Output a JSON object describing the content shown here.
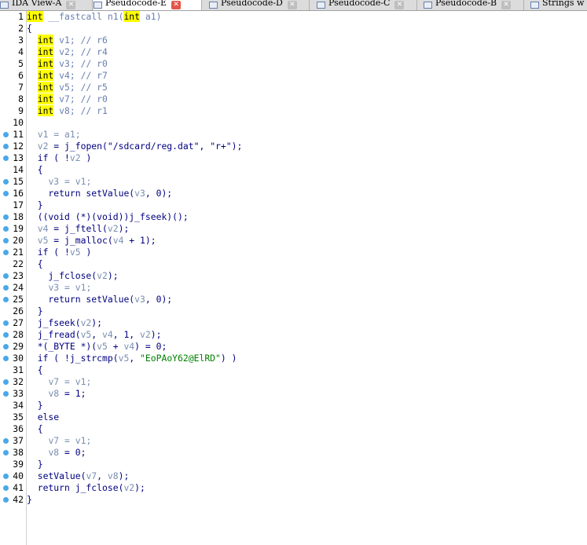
{
  "tabs": [
    {
      "label": "IDA View-A",
      "active": false
    },
    {
      "label": "Pseudocode-E",
      "active": true
    },
    {
      "label": "Pseudocode-D",
      "active": false
    },
    {
      "label": "Pseudocode-C",
      "active": false
    },
    {
      "label": "Pseudocode-B",
      "active": false
    },
    {
      "label": "Strings w",
      "active": false
    }
  ],
  "colors": {
    "keyword_highlight": "#ffff00",
    "breakpoint_dot": "#4aa8e8",
    "string": "#008000",
    "variable": "#7a8fb0",
    "code": "#000080"
  },
  "lines": [
    {
      "n": "1",
      "bp": false,
      "tokens": [
        {
          "t": "int",
          "c": "kw"
        },
        {
          "t": " __fastcall n1(",
          "c": "cmt"
        },
        {
          "t": "int",
          "c": "kw"
        },
        {
          "t": " a1)",
          "c": "cmt"
        }
      ]
    },
    {
      "n": "2",
      "bp": false,
      "tokens": [
        {
          "t": "{",
          "c": "fn"
        }
      ]
    },
    {
      "n": "3",
      "bp": false,
      "tokens": [
        {
          "t": "  ",
          "c": "fn"
        },
        {
          "t": "int",
          "c": "kw"
        },
        {
          "t": " v1; // r6",
          "c": "cmt"
        }
      ]
    },
    {
      "n": "4",
      "bp": false,
      "tokens": [
        {
          "t": "  ",
          "c": "fn"
        },
        {
          "t": "int",
          "c": "kw"
        },
        {
          "t": " v2; // r4",
          "c": "cmt"
        }
      ]
    },
    {
      "n": "5",
      "bp": false,
      "tokens": [
        {
          "t": "  ",
          "c": "fn"
        },
        {
          "t": "int",
          "c": "kw"
        },
        {
          "t": " v3; // r0",
          "c": "cmt"
        }
      ]
    },
    {
      "n": "6",
      "bp": false,
      "tokens": [
        {
          "t": "  ",
          "c": "fn"
        },
        {
          "t": "int",
          "c": "kw"
        },
        {
          "t": " v4; // r7",
          "c": "cmt"
        }
      ]
    },
    {
      "n": "7",
      "bp": false,
      "tokens": [
        {
          "t": "  ",
          "c": "fn"
        },
        {
          "t": "int",
          "c": "kw"
        },
        {
          "t": " v5; // r5",
          "c": "cmt"
        }
      ]
    },
    {
      "n": "8",
      "bp": false,
      "tokens": [
        {
          "t": "  ",
          "c": "fn"
        },
        {
          "t": "int",
          "c": "kw"
        },
        {
          "t": " v7; // r0",
          "c": "cmt"
        }
      ]
    },
    {
      "n": "9",
      "bp": false,
      "tokens": [
        {
          "t": "  ",
          "c": "fn"
        },
        {
          "t": "int",
          "c": "kw"
        },
        {
          "t": " v8; // r1",
          "c": "cmt"
        }
      ]
    },
    {
      "n": "10",
      "bp": false,
      "tokens": []
    },
    {
      "n": "11",
      "bp": true,
      "tokens": [
        {
          "t": "  ",
          "c": "fn"
        },
        {
          "t": "v1 = a1;",
          "c": "var"
        }
      ]
    },
    {
      "n": "12",
      "bp": true,
      "tokens": [
        {
          "t": "  ",
          "c": "fn"
        },
        {
          "t": "v2",
          "c": "var"
        },
        {
          "t": " = j_fopen(",
          "c": "fn"
        },
        {
          "t": "\"/sdcard/reg.dat\"",
          "c": "fn"
        },
        {
          "t": ", ",
          "c": "fn"
        },
        {
          "t": "\"r+\"",
          "c": "fn"
        },
        {
          "t": ");",
          "c": "fn"
        }
      ]
    },
    {
      "n": "13",
      "bp": true,
      "tokens": [
        {
          "t": "  if ( !",
          "c": "fn"
        },
        {
          "t": "v2",
          "c": "var"
        },
        {
          "t": " )",
          "c": "fn"
        }
      ]
    },
    {
      "n": "14",
      "bp": false,
      "tokens": [
        {
          "t": "  {",
          "c": "fn"
        }
      ]
    },
    {
      "n": "15",
      "bp": true,
      "tokens": [
        {
          "t": "    ",
          "c": "fn"
        },
        {
          "t": "v3 = v1;",
          "c": "var"
        }
      ]
    },
    {
      "n": "16",
      "bp": true,
      "tokens": [
        {
          "t": "    return setValue(",
          "c": "fn"
        },
        {
          "t": "v3",
          "c": "var"
        },
        {
          "t": ", 0);",
          "c": "fn"
        }
      ]
    },
    {
      "n": "17",
      "bp": false,
      "tokens": [
        {
          "t": "  }",
          "c": "fn"
        }
      ]
    },
    {
      "n": "18",
      "bp": true,
      "tokens": [
        {
          "t": "  ((void (*)(void))j_fseek)();",
          "c": "fn"
        }
      ]
    },
    {
      "n": "19",
      "bp": true,
      "tokens": [
        {
          "t": "  ",
          "c": "fn"
        },
        {
          "t": "v4",
          "c": "var"
        },
        {
          "t": " = j_ftell(",
          "c": "fn"
        },
        {
          "t": "v2",
          "c": "var"
        },
        {
          "t": ");",
          "c": "fn"
        }
      ]
    },
    {
      "n": "20",
      "bp": true,
      "tokens": [
        {
          "t": "  ",
          "c": "fn"
        },
        {
          "t": "v5",
          "c": "var"
        },
        {
          "t": " = j_malloc(",
          "c": "fn"
        },
        {
          "t": "v4",
          "c": "var"
        },
        {
          "t": " + 1);",
          "c": "fn"
        }
      ]
    },
    {
      "n": "21",
      "bp": true,
      "tokens": [
        {
          "t": "  if ( !",
          "c": "fn"
        },
        {
          "t": "v5",
          "c": "var"
        },
        {
          "t": " )",
          "c": "fn"
        }
      ]
    },
    {
      "n": "22",
      "bp": false,
      "tokens": [
        {
          "t": "  {",
          "c": "fn"
        }
      ]
    },
    {
      "n": "23",
      "bp": true,
      "tokens": [
        {
          "t": "    j_fclose(",
          "c": "fn"
        },
        {
          "t": "v2",
          "c": "var"
        },
        {
          "t": ");",
          "c": "fn"
        }
      ]
    },
    {
      "n": "24",
      "bp": true,
      "tokens": [
        {
          "t": "    ",
          "c": "fn"
        },
        {
          "t": "v3 = v1;",
          "c": "var"
        }
      ]
    },
    {
      "n": "25",
      "bp": true,
      "tokens": [
        {
          "t": "    return setValue(",
          "c": "fn"
        },
        {
          "t": "v3",
          "c": "var"
        },
        {
          "t": ", 0);",
          "c": "fn"
        }
      ]
    },
    {
      "n": "26",
      "bp": false,
      "tokens": [
        {
          "t": "  }",
          "c": "fn"
        }
      ]
    },
    {
      "n": "27",
      "bp": true,
      "tokens": [
        {
          "t": "  j_fseek(",
          "c": "fn"
        },
        {
          "t": "v2",
          "c": "var"
        },
        {
          "t": ");",
          "c": "fn"
        }
      ]
    },
    {
      "n": "28",
      "bp": true,
      "tokens": [
        {
          "t": "  j_fread(",
          "c": "fn"
        },
        {
          "t": "v5",
          "c": "var"
        },
        {
          "t": ", ",
          "c": "fn"
        },
        {
          "t": "v4",
          "c": "var"
        },
        {
          "t": ", 1, ",
          "c": "fn"
        },
        {
          "t": "v2",
          "c": "var"
        },
        {
          "t": ");",
          "c": "fn"
        }
      ]
    },
    {
      "n": "29",
      "bp": true,
      "tokens": [
        {
          "t": "  *(_BYTE *)(",
          "c": "fn"
        },
        {
          "t": "v5",
          "c": "var"
        },
        {
          "t": " + ",
          "c": "fn"
        },
        {
          "t": "v4",
          "c": "var"
        },
        {
          "t": ") = 0;",
          "c": "fn"
        }
      ]
    },
    {
      "n": "30",
      "bp": true,
      "tokens": [
        {
          "t": "  if ( !j_strcmp(",
          "c": "fn"
        },
        {
          "t": "v5",
          "c": "var"
        },
        {
          "t": ", ",
          "c": "fn"
        },
        {
          "t": "\"EoPAoY62@ElRD\"",
          "c": "str"
        },
        {
          "t": ") )",
          "c": "fn"
        }
      ]
    },
    {
      "n": "31",
      "bp": false,
      "tokens": [
        {
          "t": "  {",
          "c": "fn"
        }
      ]
    },
    {
      "n": "32",
      "bp": true,
      "tokens": [
        {
          "t": "    ",
          "c": "fn"
        },
        {
          "t": "v7 = v1;",
          "c": "var"
        }
      ]
    },
    {
      "n": "33",
      "bp": true,
      "tokens": [
        {
          "t": "    ",
          "c": "fn"
        },
        {
          "t": "v8",
          "c": "var"
        },
        {
          "t": " = 1;",
          "c": "fn"
        }
      ]
    },
    {
      "n": "34",
      "bp": false,
      "tokens": [
        {
          "t": "  }",
          "c": "fn"
        }
      ]
    },
    {
      "n": "35",
      "bp": false,
      "tokens": [
        {
          "t": "  else",
          "c": "fn"
        }
      ]
    },
    {
      "n": "36",
      "bp": false,
      "tokens": [
        {
          "t": "  {",
          "c": "fn"
        }
      ]
    },
    {
      "n": "37",
      "bp": true,
      "tokens": [
        {
          "t": "    ",
          "c": "fn"
        },
        {
          "t": "v7 = v1;",
          "c": "var"
        }
      ]
    },
    {
      "n": "38",
      "bp": true,
      "tokens": [
        {
          "t": "    ",
          "c": "fn"
        },
        {
          "t": "v8",
          "c": "var"
        },
        {
          "t": " = 0;",
          "c": "fn"
        }
      ]
    },
    {
      "n": "39",
      "bp": false,
      "tokens": [
        {
          "t": "  }",
          "c": "fn"
        }
      ]
    },
    {
      "n": "40",
      "bp": true,
      "tokens": [
        {
          "t": "  setValue(",
          "c": "fn"
        },
        {
          "t": "v7",
          "c": "var"
        },
        {
          "t": ", ",
          "c": "fn"
        },
        {
          "t": "v8",
          "c": "var"
        },
        {
          "t": ");",
          "c": "fn"
        }
      ]
    },
    {
      "n": "41",
      "bp": true,
      "tokens": [
        {
          "t": "  return j_fclose(",
          "c": "fn"
        },
        {
          "t": "v2",
          "c": "var"
        },
        {
          "t": ");",
          "c": "fn"
        }
      ]
    },
    {
      "n": "42",
      "bp": true,
      "tokens": [
        {
          "t": "}",
          "c": "fn"
        }
      ]
    }
  ]
}
